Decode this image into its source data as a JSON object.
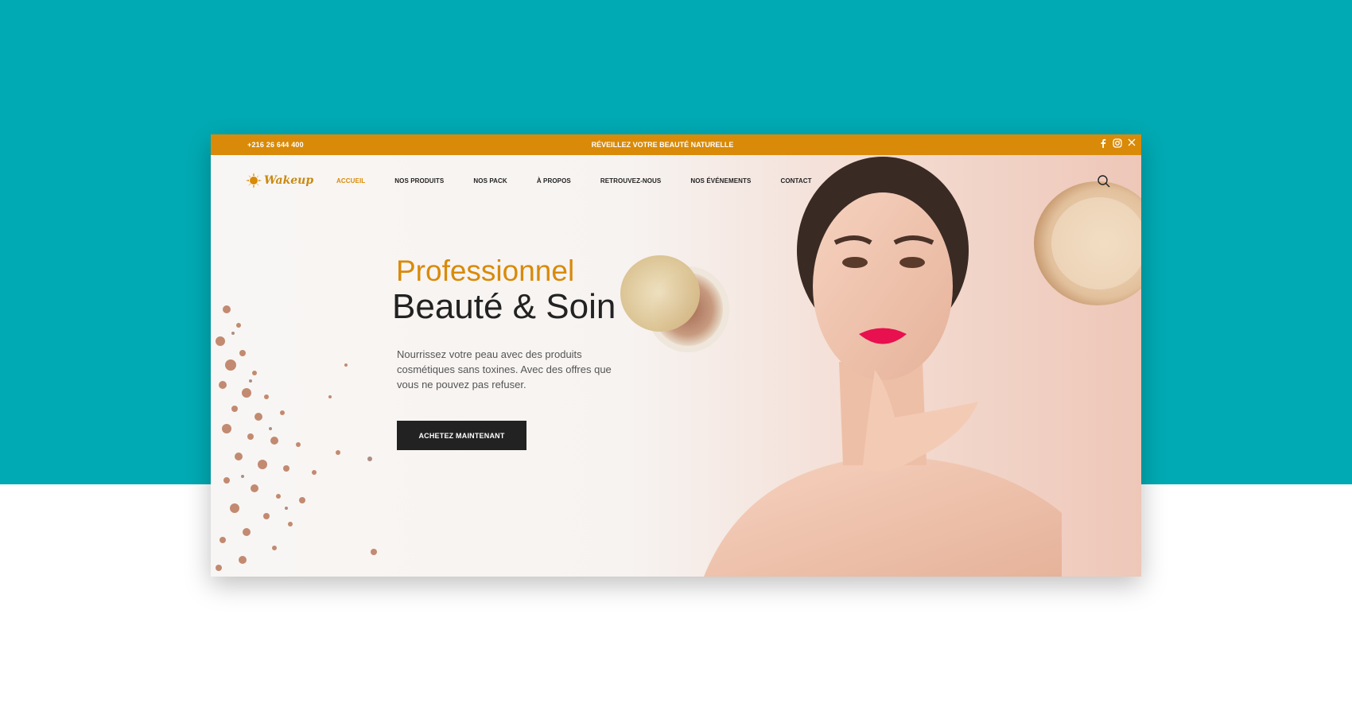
{
  "topbar": {
    "phone": "+216 26 644 400",
    "tagline": "RÉVEILLEZ VOTRE BEAUTÉ NATURELLE",
    "social_icons": [
      "facebook-icon",
      "instagram-icon",
      "close-icon"
    ]
  },
  "logo": {
    "text": "Wakeup"
  },
  "nav": {
    "items": [
      {
        "label": "ACCUEIL",
        "active": true
      },
      {
        "label": "NOS PRODUITS",
        "active": false
      },
      {
        "label": "NOS PACK",
        "active": false
      },
      {
        "label": "À PROPOS",
        "active": false
      },
      {
        "label": "RETROUVEZ-NOUS",
        "active": false
      },
      {
        "label": "NOS ÉVÉNEMENTS",
        "active": false
      },
      {
        "label": "CONTACT",
        "active": false
      }
    ]
  },
  "hero": {
    "subtitle": "Professionnel",
    "title": "Beauté & Soin",
    "description": "Nourrissez votre peau avec des produits cosmétiques sans toxines. Avec des offres que vous ne pouvez pas refuser.",
    "cta_label": "ACHETEZ MAINTENANT"
  },
  "colors": {
    "page_background": "#00aab4",
    "accent": "#d98a08",
    "dark": "#222222"
  }
}
